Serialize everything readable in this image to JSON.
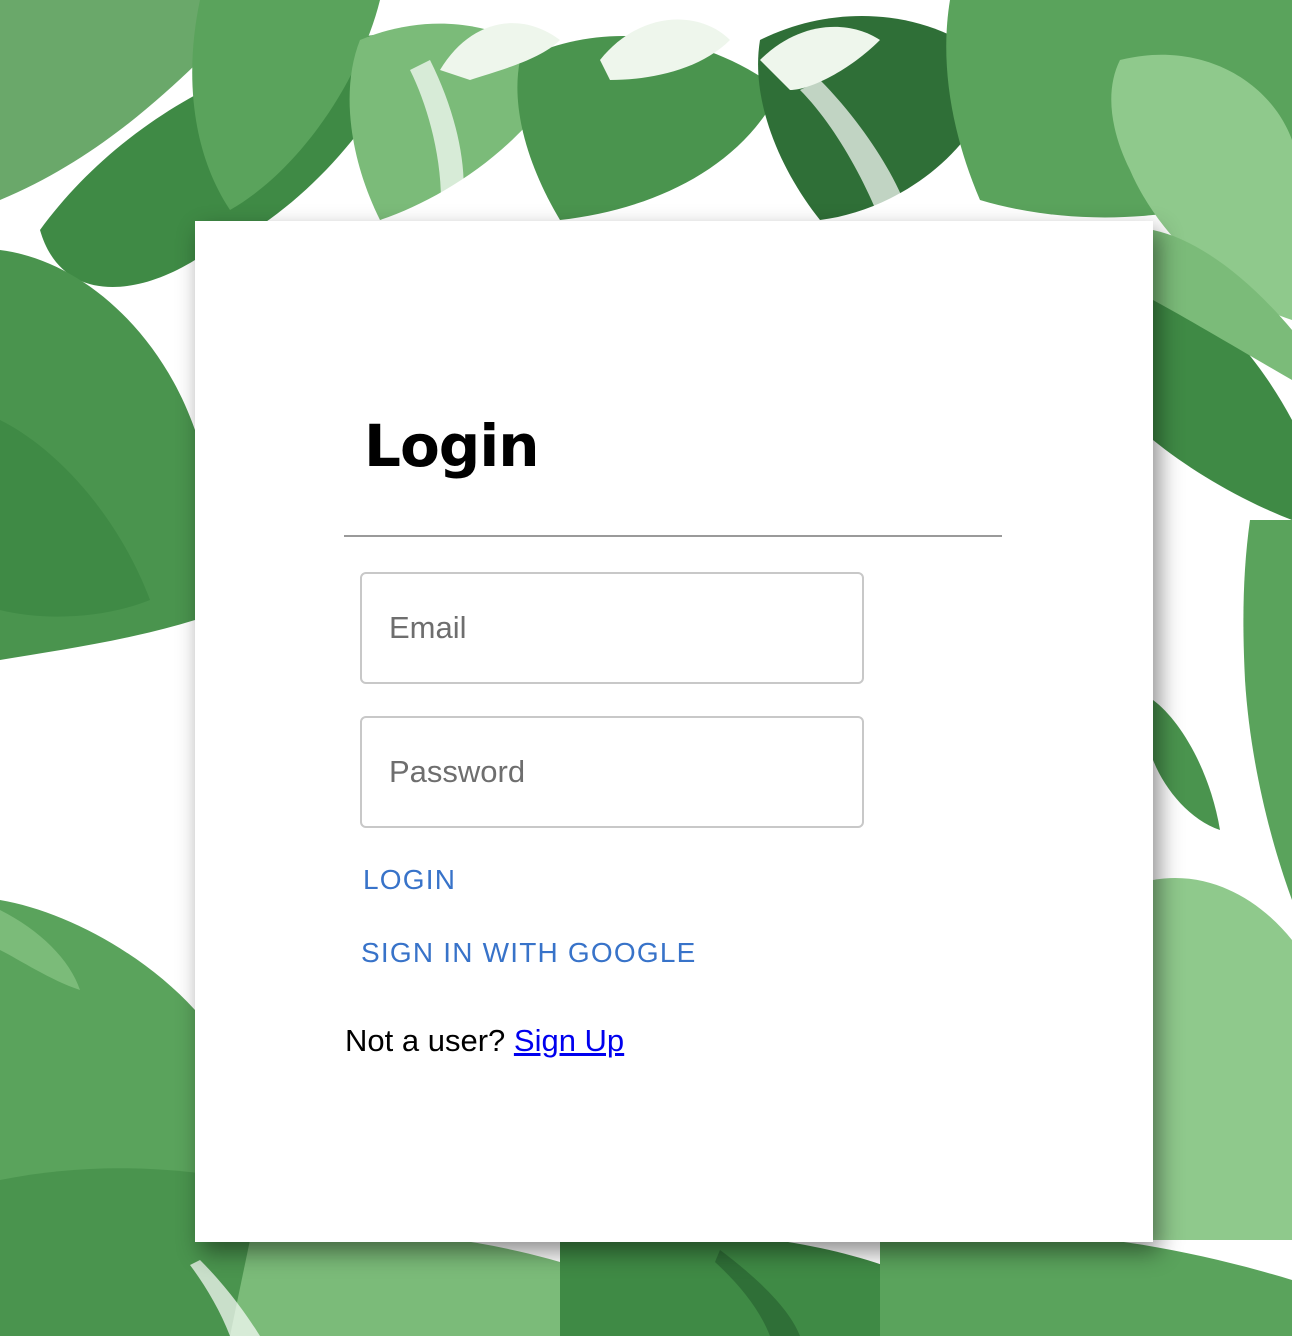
{
  "background": {
    "leaf_colors": [
      "#3f8a45",
      "#5aa35c",
      "#7bbb79",
      "#2f6f37",
      "#8fc98c"
    ],
    "logo_text_color": "#eef6ec"
  },
  "login": {
    "title": "Login",
    "email": {
      "value": "",
      "placeholder": "Email"
    },
    "password": {
      "value": "",
      "placeholder": "Password"
    },
    "login_label": "LOGIN",
    "google_label": "SIGN IN WITH GOOGLE",
    "signup_prompt": "Not a user?",
    "signup_link_label": "Sign Up",
    "accent_color": "#3873c9",
    "link_color": "#0000ee"
  }
}
